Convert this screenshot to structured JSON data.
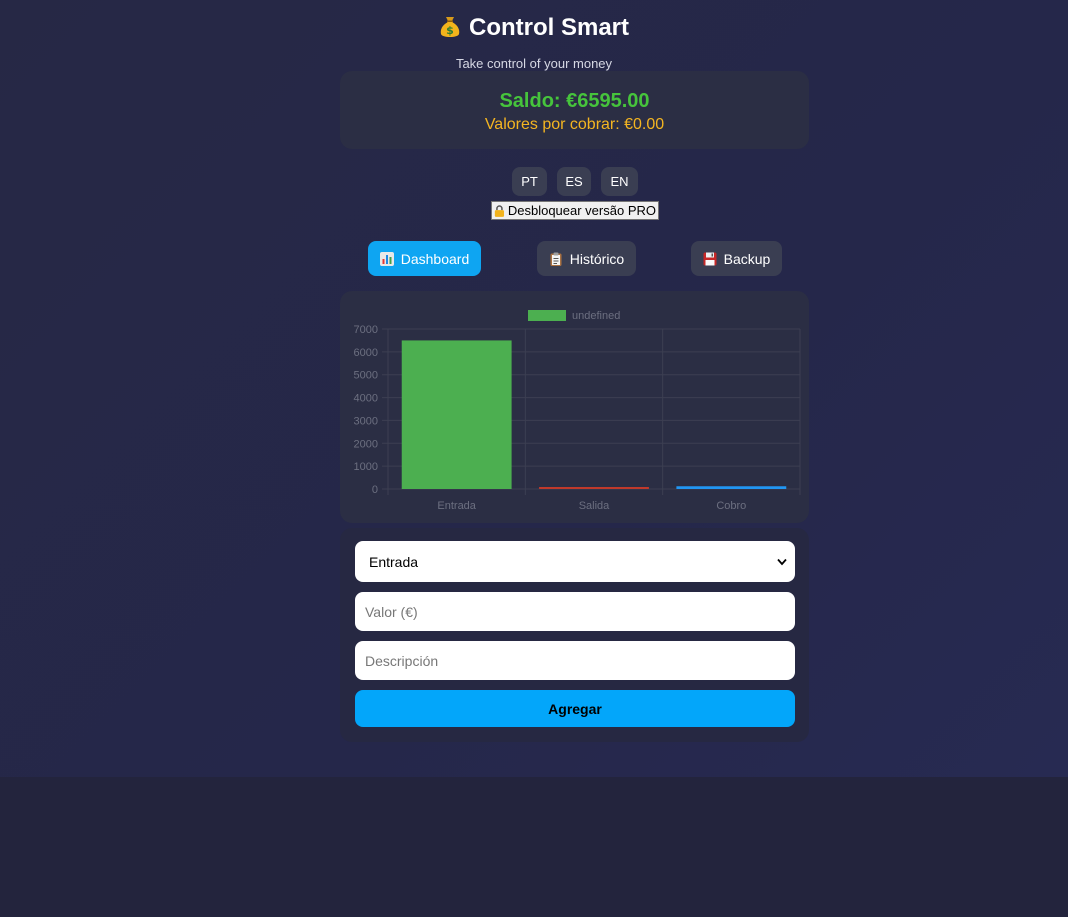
{
  "header": {
    "title": "Control Smart",
    "subtitle": "Take control of your money"
  },
  "balance": {
    "main_label": "Saldo: €6595.00",
    "pending_label": "Valores por cobrar: €0.00"
  },
  "languages": [
    "PT",
    "ES",
    "EN"
  ],
  "pro_button": "Desbloquear versão PRO",
  "nav": {
    "dashboard": "Dashboard",
    "history": "Histórico",
    "backup": "Backup"
  },
  "colors": {
    "accent": "#0ea5f2",
    "income": "#4caf50",
    "expense": "#c0392b",
    "collection": "#2196f3"
  },
  "chart_data": {
    "type": "bar",
    "categories": [
      "Entrada",
      "Salida",
      "Cobro"
    ],
    "values": [
      6500,
      50,
      120
    ],
    "bar_colors": [
      "#4caf50",
      "#c0392b",
      "#2196f3"
    ],
    "legend": [
      "undefined"
    ],
    "legend_position": "top",
    "ylim": [
      0,
      7000
    ],
    "yticks": [
      0,
      1000,
      2000,
      3000,
      4000,
      5000,
      6000,
      7000
    ],
    "grid": true
  },
  "form": {
    "type_select_value": "Entrada",
    "value_placeholder": "Valor (€)",
    "description_placeholder": "Descripción",
    "submit_label": "Agregar"
  }
}
